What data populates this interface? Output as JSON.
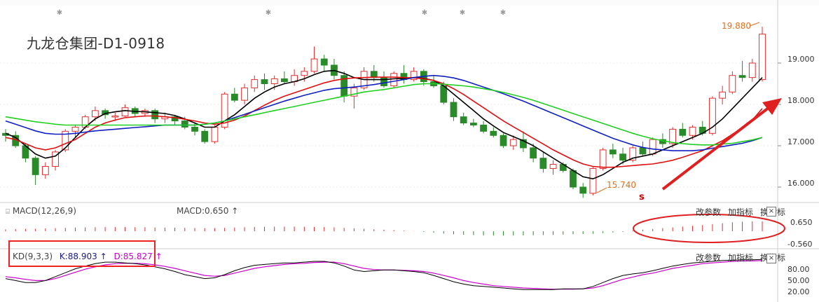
{
  "title": "九龙仓集团-D1-0918",
  "main": {
    "high_label": "19.880",
    "low_label": "15.740",
    "y_ticks": [
      "19.000",
      "18.000",
      "17.000",
      "16.000"
    ],
    "marker_s": "s"
  },
  "macd": {
    "name": "MACD(12,26,9)",
    "value_label": "MACD:0.650",
    "arrow": "↑",
    "y_ticks": [
      "0.650",
      "-0.560"
    ]
  },
  "kd": {
    "name": "KD(9,3,3)",
    "k_label": "K:88.903",
    "k_arrow": "↑",
    "d_label": "D:85.827",
    "d_arrow": "↑",
    "y_ticks": [
      "80.00",
      "50.00",
      "20.00"
    ]
  },
  "tools": {
    "modify": "改参数",
    "add": "加指标",
    "switch": "换指标",
    "close": "×"
  },
  "colors": {
    "up": "#e03030",
    "down": "#2a8a2a",
    "ma_black": "#000000",
    "ma_red": "#e01010",
    "ma_blue": "#1020c0",
    "ma_green": "#20d020",
    "k": "#000000",
    "d": "#cc00cc",
    "annotation": "#e02020"
  },
  "chart_data": {
    "type": "candlestick",
    "ylim": [
      15.7,
      20.0
    ],
    "high": 19.88,
    "low": 15.74,
    "candles": [
      [
        17.3,
        17.4,
        17.1,
        17.25
      ],
      [
        17.25,
        17.35,
        16.95,
        17.0
      ],
      [
        17.0,
        17.05,
        16.6,
        16.7
      ],
      [
        16.7,
        16.75,
        16.05,
        16.3
      ],
      [
        16.3,
        16.6,
        16.2,
        16.5
      ],
      [
        16.5,
        16.9,
        16.4,
        16.85
      ],
      [
        16.9,
        17.4,
        16.85,
        17.35
      ],
      [
        17.35,
        17.5,
        17.2,
        17.45
      ],
      [
        17.45,
        17.75,
        17.4,
        17.7
      ],
      [
        17.7,
        17.95,
        17.6,
        17.85
      ],
      [
        17.85,
        17.9,
        17.65,
        17.75
      ],
      [
        17.7,
        17.8,
        17.6,
        17.72
      ],
      [
        17.72,
        18.0,
        17.7,
        17.92
      ],
      [
        17.9,
        17.95,
        17.7,
        17.78
      ],
      [
        17.78,
        17.9,
        17.7,
        17.85
      ],
      [
        17.85,
        17.9,
        17.55,
        17.65
      ],
      [
        17.65,
        17.8,
        17.55,
        17.7
      ],
      [
        17.7,
        17.75,
        17.5,
        17.6
      ],
      [
        17.6,
        17.7,
        17.4,
        17.45
      ],
      [
        17.45,
        17.55,
        17.25,
        17.35
      ],
      [
        17.35,
        17.4,
        17.05,
        17.1
      ],
      [
        17.1,
        17.5,
        17.05,
        17.45
      ],
      [
        17.45,
        18.3,
        17.4,
        18.25
      ],
      [
        18.25,
        18.4,
        18.05,
        18.1
      ],
      [
        18.1,
        18.5,
        18.0,
        18.4
      ],
      [
        18.4,
        18.7,
        18.3,
        18.6
      ],
      [
        18.6,
        18.75,
        18.35,
        18.5
      ],
      [
        18.5,
        18.7,
        18.35,
        18.62
      ],
      [
        18.62,
        18.8,
        18.5,
        18.55
      ],
      [
        18.55,
        18.85,
        18.45,
        18.7
      ],
      [
        18.7,
        18.9,
        18.55,
        18.8
      ],
      [
        18.8,
        19.4,
        18.75,
        19.1
      ],
      [
        19.1,
        19.2,
        18.8,
        18.95
      ],
      [
        18.95,
        19.1,
        18.6,
        18.7
      ],
      [
        18.7,
        18.8,
        18.05,
        18.2
      ],
      [
        18.2,
        18.5,
        17.9,
        18.4
      ],
      [
        18.4,
        18.9,
        18.35,
        18.8
      ],
      [
        18.8,
        18.95,
        18.55,
        18.65
      ],
      [
        18.65,
        18.8,
        18.4,
        18.45
      ],
      [
        18.45,
        18.8,
        18.4,
        18.75
      ],
      [
        18.75,
        18.95,
        18.5,
        18.6
      ],
      [
        18.6,
        18.9,
        18.55,
        18.8
      ],
      [
        18.8,
        18.85,
        18.45,
        18.55
      ],
      [
        18.55,
        18.7,
        18.4,
        18.45
      ],
      [
        18.45,
        18.55,
        18.0,
        18.05
      ],
      [
        18.05,
        18.15,
        17.6,
        17.7
      ],
      [
        17.7,
        17.8,
        17.5,
        17.55
      ],
      [
        17.55,
        17.65,
        17.45,
        17.5
      ],
      [
        17.5,
        17.6,
        17.3,
        17.35
      ],
      [
        17.35,
        17.45,
        17.2,
        17.25
      ],
      [
        17.25,
        17.3,
        16.95,
        17.0
      ],
      [
        17.0,
        17.25,
        16.9,
        17.15
      ],
      [
        17.15,
        17.35,
        16.85,
        16.95
      ],
      [
        16.95,
        17.05,
        16.6,
        16.7
      ],
      [
        16.7,
        16.85,
        16.35,
        16.45
      ],
      [
        16.45,
        16.65,
        16.3,
        16.55
      ],
      [
        16.55,
        16.6,
        16.35,
        16.4
      ],
      [
        16.4,
        16.45,
        15.95,
        16.0
      ],
      [
        16.0,
        16.1,
        15.74,
        15.85
      ],
      [
        15.85,
        16.5,
        15.8,
        16.45
      ],
      [
        16.45,
        16.95,
        16.4,
        16.9
      ],
      [
        16.9,
        17.05,
        16.7,
        16.8
      ],
      [
        16.8,
        16.95,
        16.55,
        16.65
      ],
      [
        16.65,
        17.0,
        16.6,
        16.95
      ],
      [
        16.95,
        17.1,
        16.75,
        16.8
      ],
      [
        16.8,
        17.2,
        16.75,
        17.15
      ],
      [
        17.15,
        17.3,
        16.95,
        17.05
      ],
      [
        17.05,
        17.45,
        16.95,
        17.4
      ],
      [
        17.4,
        17.55,
        17.2,
        17.25
      ],
      [
        17.25,
        17.5,
        17.15,
        17.45
      ],
      [
        17.45,
        17.6,
        17.25,
        17.3
      ],
      [
        17.3,
        18.2,
        17.25,
        18.15
      ],
      [
        18.15,
        18.45,
        18.0,
        18.3
      ],
      [
        18.3,
        18.8,
        18.25,
        18.7
      ],
      [
        18.7,
        19.05,
        18.55,
        18.65
      ],
      [
        18.65,
        19.1,
        18.55,
        19.0
      ],
      [
        18.6,
        19.88,
        18.55,
        19.7
      ]
    ],
    "ma_series": [
      {
        "color": "black",
        "values": [
          17.3,
          17.2,
          17.0,
          16.8,
          16.7,
          16.75,
          16.95,
          17.2,
          17.45,
          17.65,
          17.78,
          17.82,
          17.85,
          17.83,
          17.82,
          17.8,
          17.78,
          17.73,
          17.65,
          17.55,
          17.45,
          17.45,
          17.6,
          17.75,
          17.95,
          18.15,
          18.3,
          18.42,
          18.5,
          18.55,
          18.62,
          18.72,
          18.8,
          18.82,
          18.75,
          18.65,
          18.6,
          18.6,
          18.6,
          18.62,
          18.63,
          18.65,
          18.63,
          18.58,
          18.45,
          18.25,
          18.05,
          17.85,
          17.65,
          17.48,
          17.32,
          17.22,
          17.12,
          17.0,
          16.85,
          16.7,
          16.55,
          16.4,
          16.25,
          16.2,
          16.3,
          16.45,
          16.6,
          16.7,
          16.75,
          16.8,
          16.9,
          17.0,
          17.1,
          17.2,
          17.3,
          17.45,
          17.65,
          17.9,
          18.15,
          18.4,
          18.65
        ]
      },
      {
        "color": "red",
        "values": [
          17.2,
          17.15,
          17.05,
          16.95,
          16.9,
          16.95,
          17.05,
          17.15,
          17.3,
          17.45,
          17.55,
          17.62,
          17.68,
          17.7,
          17.72,
          17.72,
          17.7,
          17.68,
          17.64,
          17.6,
          17.55,
          17.52,
          17.55,
          17.62,
          17.72,
          17.85,
          17.98,
          18.1,
          18.2,
          18.28,
          18.36,
          18.44,
          18.52,
          18.58,
          18.62,
          18.64,
          18.65,
          18.66,
          18.66,
          18.66,
          18.65,
          18.64,
          18.62,
          18.58,
          18.5,
          18.38,
          18.24,
          18.08,
          17.92,
          17.76,
          17.6,
          17.46,
          17.32,
          17.18,
          17.04,
          16.9,
          16.78,
          16.66,
          16.56,
          16.5,
          16.48,
          16.48,
          16.5,
          16.52,
          16.54,
          16.56,
          16.6,
          16.65,
          16.72,
          16.8,
          16.88,
          17.0,
          17.12,
          17.28,
          17.44,
          17.62,
          17.9
        ]
      },
      {
        "color": "blue",
        "values": [
          17.6,
          17.52,
          17.44,
          17.36,
          17.3,
          17.28,
          17.28,
          17.3,
          17.33,
          17.36,
          17.38,
          17.4,
          17.42,
          17.44,
          17.46,
          17.48,
          17.5,
          17.5,
          17.5,
          17.5,
          17.52,
          17.55,
          17.6,
          17.68,
          17.76,
          17.84,
          17.92,
          18.0,
          18.08,
          18.15,
          18.22,
          18.28,
          18.34,
          18.38,
          18.4,
          18.42,
          18.45,
          18.48,
          18.52,
          18.56,
          18.6,
          18.65,
          18.68,
          18.7,
          18.68,
          18.64,
          18.58,
          18.5,
          18.42,
          18.34,
          18.26,
          18.17,
          18.08,
          17.98,
          17.88,
          17.78,
          17.68,
          17.58,
          17.48,
          17.38,
          17.28,
          17.18,
          17.1,
          17.02,
          16.96,
          16.92,
          16.9,
          16.88,
          16.88,
          16.88,
          16.9,
          16.94,
          16.98,
          17.02,
          17.06,
          17.12,
          17.2
        ]
      },
      {
        "color": "green",
        "values": [
          17.7,
          17.66,
          17.62,
          17.58,
          17.55,
          17.52,
          17.5,
          17.5,
          17.5,
          17.5,
          17.5,
          17.5,
          17.5,
          17.5,
          17.5,
          17.5,
          17.5,
          17.5,
          17.5,
          17.5,
          17.52,
          17.55,
          17.6,
          17.65,
          17.7,
          17.75,
          17.8,
          17.85,
          17.9,
          17.95,
          18.0,
          18.05,
          18.1,
          18.15,
          18.2,
          18.25,
          18.3,
          18.33,
          18.36,
          18.4,
          18.44,
          18.48,
          18.5,
          18.5,
          18.49,
          18.47,
          18.45,
          18.42,
          18.38,
          18.34,
          18.29,
          18.23,
          18.17,
          18.1,
          18.02,
          17.94,
          17.86,
          17.78,
          17.7,
          17.62,
          17.54,
          17.46,
          17.38,
          17.3,
          17.23,
          17.17,
          17.12,
          17.08,
          17.05,
          17.03,
          17.02,
          17.02,
          17.04,
          17.06,
          17.1,
          17.14,
          17.2
        ]
      }
    ],
    "macd_values": [
      0.12,
      0.14,
      0.15,
      0.16,
      0.18,
      0.2,
      0.22,
      0.24,
      0.25,
      0.26,
      0.27,
      0.27,
      0.27,
      0.26,
      0.26,
      0.25,
      0.24,
      0.23,
      0.22,
      0.21,
      0.2,
      0.2,
      0.22,
      0.24,
      0.26,
      0.28,
      0.29,
      0.3,
      0.3,
      0.3,
      0.29,
      0.28,
      0.27,
      0.25,
      0.22,
      0.19,
      0.16,
      0.13,
      0.1,
      0.07,
      0.04,
      0.01,
      -0.05,
      -0.1,
      -0.15,
      -0.2,
      -0.23,
      -0.25,
      -0.27,
      -0.28,
      -0.28,
      -0.28,
      -0.27,
      -0.26,
      -0.25,
      -0.24,
      -0.22,
      -0.2,
      -0.18,
      -0.16,
      -0.12,
      -0.08,
      -0.05,
      0.05,
      0.1,
      0.15,
      0.2,
      0.25,
      0.3,
      0.35,
      0.4,
      0.46,
      0.52,
      0.58,
      0.62,
      0.64,
      0.65
    ],
    "kd_k": [
      40,
      35,
      30,
      30,
      35,
      45,
      55,
      65,
      72,
      78,
      82,
      82,
      80,
      78,
      75,
      70,
      65,
      58,
      50,
      45,
      40,
      42,
      50,
      60,
      68,
      74,
      76,
      78,
      80,
      80,
      82,
      84,
      84,
      80,
      72,
      62,
      58,
      60,
      62,
      62,
      60,
      58,
      55,
      48,
      40,
      32,
      26,
      22,
      20,
      18,
      16,
      14,
      12,
      12,
      12,
      12,
      14,
      14,
      14,
      20,
      30,
      40,
      48,
      52,
      55,
      60,
      66,
      72,
      76,
      80,
      82,
      84,
      86,
      87,
      88,
      88,
      89
    ],
    "kd_d": [
      45,
      42,
      38,
      35,
      35,
      40,
      48,
      56,
      64,
      70,
      75,
      78,
      79,
      79,
      78,
      75,
      71,
      66,
      60,
      54,
      48,
      46,
      48,
      54,
      60,
      66,
      70,
      73,
      76,
      78,
      79,
      81,
      82,
      82,
      78,
      72,
      66,
      63,
      62,
      62,
      61,
      60,
      58,
      54,
      48,
      42,
      35,
      30,
      26,
      22,
      20,
      18,
      16,
      15,
      14,
      13,
      13,
      13,
      14,
      16,
      22,
      30,
      38,
      44,
      50,
      54,
      60,
      66,
      70,
      74,
      78,
      80,
      82,
      84,
      85,
      85,
      86
    ]
  }
}
